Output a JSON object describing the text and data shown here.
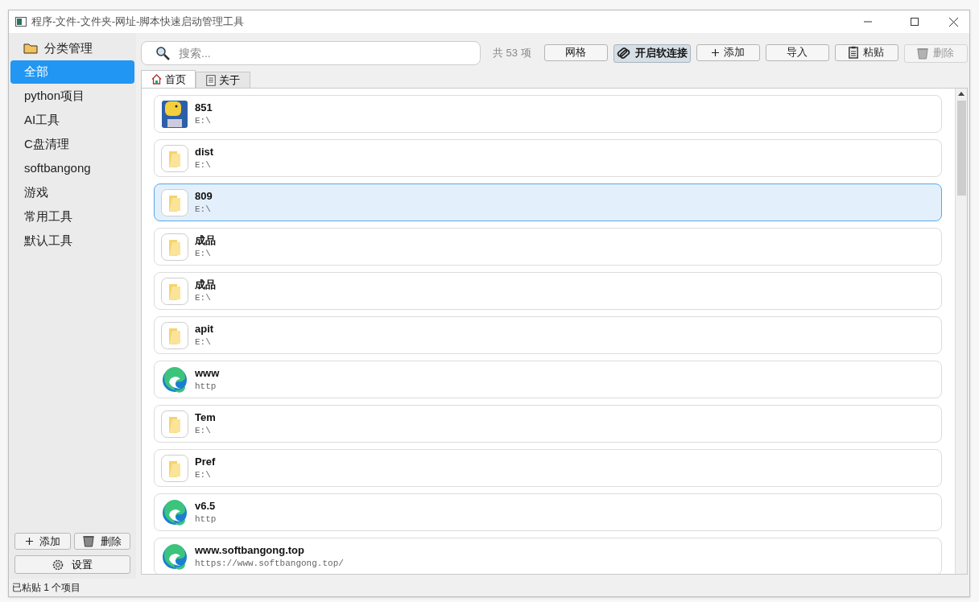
{
  "window": {
    "title": "程序-文件-文件夹-网址-脚本快速启动管理工具"
  },
  "sidebar": {
    "header": "分类管理",
    "items": [
      {
        "label": "全部",
        "selected": true
      },
      {
        "label": "python项目",
        "selected": false
      },
      {
        "label": "AI工具",
        "selected": false
      },
      {
        "label": "C盘清理",
        "selected": false
      },
      {
        "label": "softbangong",
        "selected": false
      },
      {
        "label": "游戏",
        "selected": false
      },
      {
        "label": "常用工具",
        "selected": false
      },
      {
        "label": "默认工具",
        "selected": false
      }
    ],
    "buttons": [
      {
        "kind": "add",
        "label": "添加"
      },
      {
        "kind": "delete",
        "label": "删除"
      }
    ],
    "settings_button": "设置"
  },
  "search": {
    "placeholder": "搜索..."
  },
  "count": "共 53 项",
  "toolbar": [
    {
      "kind": "grid",
      "label": "网格",
      "pressed": false,
      "disabled": false
    },
    {
      "kind": "link",
      "label": "开启软连接",
      "pressed": true,
      "disabled": false
    },
    {
      "kind": "add",
      "label": "添加",
      "pressed": false,
      "disabled": false
    },
    {
      "kind": "import",
      "label": "导入",
      "pressed": false,
      "disabled": false
    },
    {
      "kind": "paste",
      "label": "粘贴",
      "pressed": false,
      "disabled": false
    },
    {
      "kind": "delete",
      "label": "删除",
      "pressed": false,
      "disabled": true
    }
  ],
  "tabs": [
    {
      "kind": "home",
      "label": "首页",
      "selected": true
    },
    {
      "kind": "doc",
      "label": "关于",
      "selected": false
    }
  ],
  "items": [
    {
      "kind": "app",
      "name": "851",
      "path": "E:\\",
      "selected": false
    },
    {
      "kind": "folder",
      "name": "dist",
      "path": "E:\\",
      "selected": false
    },
    {
      "kind": "folder",
      "name": "809",
      "path": "E:\\",
      "selected": true
    },
    {
      "kind": "folder",
      "name": "成品",
      "path": "E:\\",
      "selected": false
    },
    {
      "kind": "folder",
      "name": "成品",
      "path": "E:\\",
      "selected": false
    },
    {
      "kind": "folder",
      "name": "apit",
      "path": "E:\\",
      "selected": false
    },
    {
      "kind": "web",
      "name": "www",
      "path": "http",
      "selected": false
    },
    {
      "kind": "folder",
      "name": "Tem",
      "path": "E:\\",
      "selected": false
    },
    {
      "kind": "folder",
      "name": "Pref",
      "path": "E:\\",
      "selected": false
    },
    {
      "kind": "web",
      "name": "v6.5",
      "path": "http",
      "selected": false
    },
    {
      "kind": "web",
      "name": "www.softbangong.top",
      "path": "https://www.softbangong.top/",
      "selected": false
    }
  ],
  "status_bar": "已粘贴 1 个项目"
}
